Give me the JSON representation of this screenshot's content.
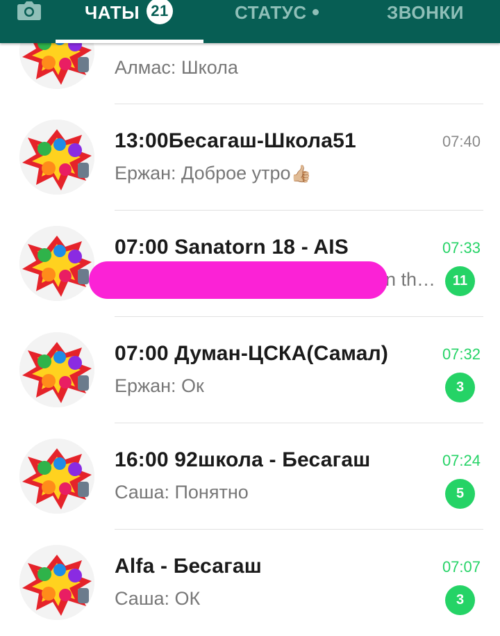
{
  "tabs": {
    "chats_label": "ЧАТЫ",
    "chats_badge": "21",
    "status_label": "СТАТУС",
    "calls_label": "ЗВОНКИ"
  },
  "chats": [
    {
      "title": "",
      "message": "Алмас: Школа",
      "time": "",
      "unread": ""
    },
    {
      "title": "13:00Бесагаш-Школа51",
      "message": "Ержан: Доброе утро",
      "emoji": "👍🏼",
      "time": "07:40",
      "unread": ""
    },
    {
      "title": "07:00 Sanatorn 18 - AIS",
      "message": "n th…",
      "time": "07:33",
      "unread": "11"
    },
    {
      "title": "07:00 Думан-ЦСКА(Самал)",
      "message": "Ержан: Ок",
      "time": "07:32",
      "unread": "3"
    },
    {
      "title": "16:00 92школа - Бесагаш",
      "message": "Саша: Понятно",
      "time": "07:24",
      "unread": "5"
    },
    {
      "title": "Alfa -  Бесагаш",
      "message": "Саша: ОК",
      "time": "07:07",
      "unread": "3"
    }
  ],
  "colors": {
    "header": "#075e54",
    "accent_green": "#25d366",
    "redaction": "#fb22d6"
  },
  "icons": {
    "camera": "camera-icon",
    "avatar": "group-avatar-image"
  }
}
